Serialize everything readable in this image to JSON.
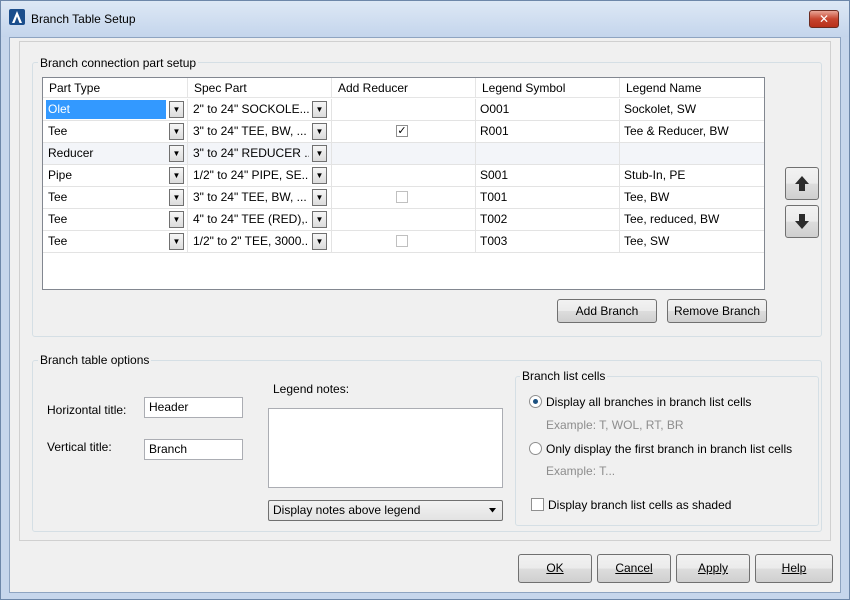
{
  "window": {
    "title": "Branch Table Setup",
    "close_glyph": "✕"
  },
  "connection_group": {
    "label": "Branch connection part setup",
    "columns": [
      "Part Type",
      "Spec Part",
      "Add Reducer",
      "Legend Symbol",
      "Legend Name"
    ],
    "rows": [
      {
        "part_type": "Olet",
        "spec_part": "2\" to 24\"  SOCKOLE...",
        "add_reducer": "none",
        "legend_symbol": "O001",
        "legend_name": "Sockolet, SW",
        "selected": true
      },
      {
        "part_type": "Tee",
        "spec_part": "3\" to 24\"  TEE, BW, ...",
        "add_reducer": "checked",
        "legend_symbol": "R001",
        "legend_name": "Tee & Reducer, BW"
      },
      {
        "part_type": "Reducer",
        "spec_part": "3\" to 24\"  REDUCER ...",
        "add_reducer": "none",
        "legend_symbol": "",
        "legend_name": ""
      },
      {
        "part_type": "Pipe",
        "spec_part": "1/2\" to 24\"  PIPE, SE...",
        "add_reducer": "none",
        "legend_symbol": "S001",
        "legend_name": "Stub-In, PE"
      },
      {
        "part_type": "Tee",
        "spec_part": "3\" to 24\"  TEE, BW, ...",
        "add_reducer": "unchecked",
        "legend_symbol": "T001",
        "legend_name": "Tee, BW"
      },
      {
        "part_type": "Tee",
        "spec_part": "4\" to 24\"  TEE (RED),...",
        "add_reducer": "none",
        "legend_symbol": "T002",
        "legend_name": "Tee, reduced, BW"
      },
      {
        "part_type": "Tee",
        "spec_part": "1/2\" to 2\"  TEE, 3000...",
        "add_reducer": "unchecked",
        "legend_symbol": "T003",
        "legend_name": "Tee, SW"
      }
    ],
    "add_branch_label": "Add Branch",
    "remove_branch_label": "Remove Branch",
    "check_glyph": "✓"
  },
  "options_group": {
    "label": "Branch table options",
    "horizontal_title_label": "Horizontal title:",
    "horizontal_title_value": "Header",
    "vertical_title_label": "Vertical title:",
    "vertical_title_value": "Branch",
    "legend_notes_label": "Legend notes:",
    "legend_notes_value": "",
    "notes_position_value": "Display notes above legend",
    "branch_list": {
      "label": "Branch list cells",
      "option_all_label": "Display all branches in branch list cells",
      "option_all_example": "Example: T, WOL, RT, BR",
      "option_first_label": "Only display the first branch in branch list cells",
      "option_first_example": "Example: T...",
      "shaded_label": "Display branch list cells as shaded"
    }
  },
  "footer": {
    "ok": "OK",
    "cancel": "Cancel",
    "apply": "Apply",
    "help": "Help"
  }
}
